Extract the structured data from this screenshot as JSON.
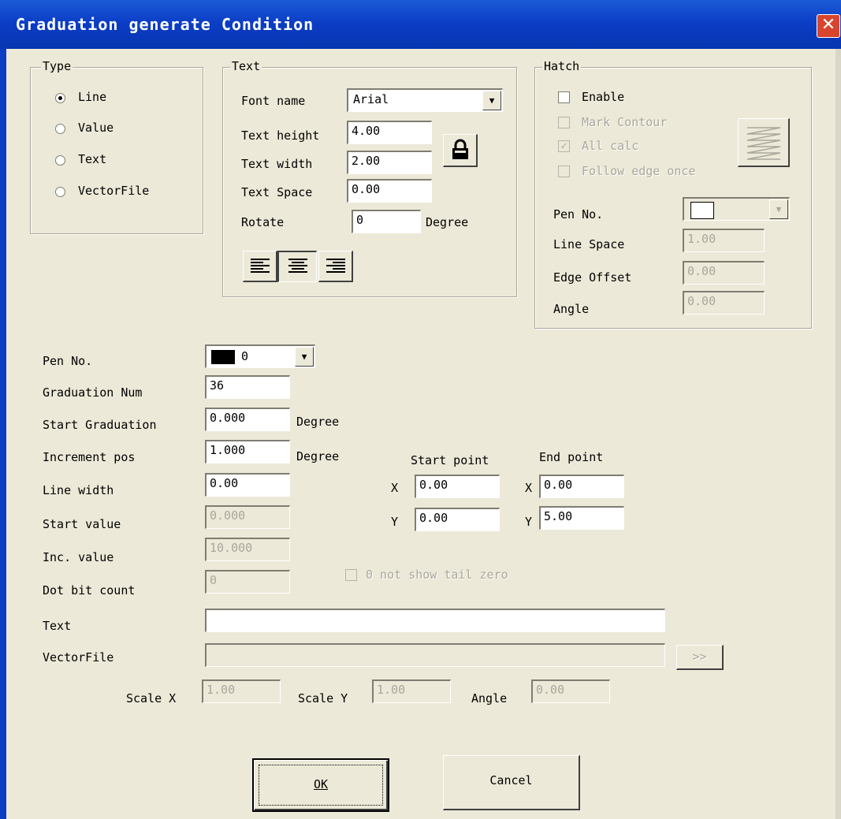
{
  "dialog": {
    "title": "Graduation generate Condition"
  },
  "type_group": {
    "label": "Type",
    "options": [
      {
        "label": "Line",
        "selected": true
      },
      {
        "label": "Value",
        "selected": false
      },
      {
        "label": "Text",
        "selected": false
      },
      {
        "label": "VectorFile",
        "selected": false
      }
    ]
  },
  "text_group": {
    "label": "Text",
    "font_name_label": "Font name",
    "font_name_value": "Arial",
    "text_height_label": "Text height",
    "text_height_value": "4.00",
    "text_width_label": "Text width",
    "text_width_value": "2.00",
    "text_space_label": "Text Space",
    "text_space_value": "0.00",
    "rotate_label": "Rotate",
    "rotate_value": "0",
    "rotate_unit": "Degree"
  },
  "hatch_group": {
    "label": "Hatch",
    "enable_label": "Enable",
    "mark_contour_label": "Mark Contour",
    "all_calc_label": "All calc",
    "follow_edge_label": "Follow edge once",
    "pen_no_label": "Pen No.",
    "line_space_label": "Line Space",
    "line_space_value": "1.00",
    "edge_offset_label": "Edge Offset",
    "edge_offset_value": "0.00",
    "angle_label": "Angle",
    "angle_value": "0.00"
  },
  "params": {
    "pen_no_label": "Pen No.",
    "pen_no_value": "0",
    "graduation_num_label": "Graduation Num",
    "graduation_num_value": "36",
    "start_graduation_label": "Start Graduation",
    "start_graduation_value": "0.000",
    "increment_pos_label": "Increment pos",
    "increment_pos_value": "1.000",
    "degree_unit": "Degree",
    "line_width_label": "Line width",
    "line_width_value": "0.00",
    "start_value_label": "Start value",
    "start_value_value": "0.000",
    "inc_value_label": "Inc. value",
    "inc_value_value": "10.000",
    "dot_bit_count_label": "Dot bit count",
    "dot_bit_count_value": "0",
    "not_show_tail_zero_label": "0 not show tail zero",
    "text_label": "Text",
    "text_value": "",
    "vectorfile_label": "VectorFile",
    "vectorfile_value": "",
    "browse_label": ">>",
    "scale_x_label": "Scale X",
    "scale_x_value": "1.00",
    "scale_y_label": "Scale Y",
    "scale_y_value": "1.00",
    "angle_label": "Angle",
    "angle_value": "0.00"
  },
  "points": {
    "start_point_label": "Start point",
    "end_point_label": "End point",
    "x_label": "X",
    "y_label": "Y",
    "start_x": "0.00",
    "start_y": "0.00",
    "end_x": "0.00",
    "end_y": "5.00"
  },
  "buttons": {
    "ok_label": "OK",
    "cancel_label": "Cancel"
  }
}
